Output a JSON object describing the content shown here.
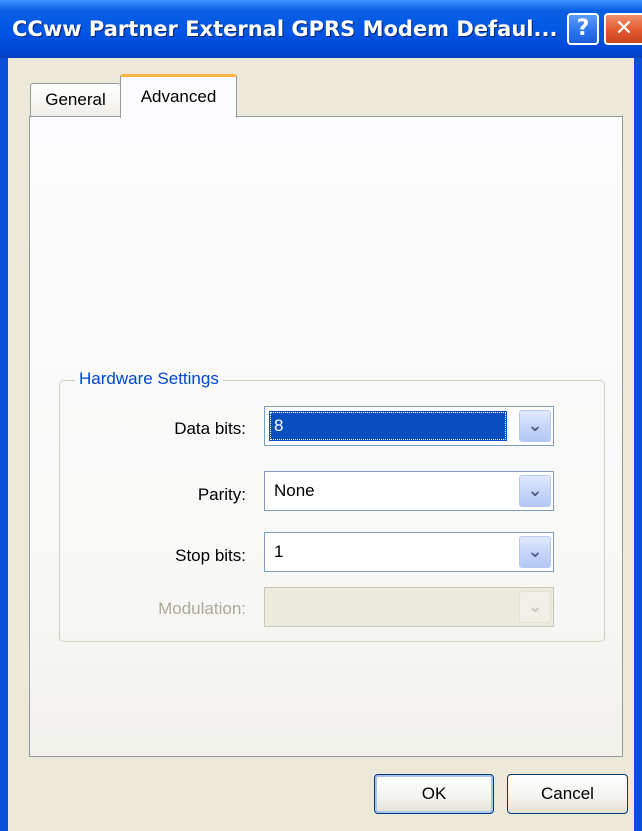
{
  "window": {
    "title": "CCww Partner External GPRS Modem Defaul...",
    "help_glyph": "?",
    "close_glyph": "✕"
  },
  "tabs": [
    {
      "label": "General",
      "active": false
    },
    {
      "label": "Advanced",
      "active": true
    }
  ],
  "hardware_settings": {
    "group_label": "Hardware Settings",
    "fields": [
      {
        "label": "Data bits:",
        "value": "8",
        "selected": true,
        "enabled": true
      },
      {
        "label": "Parity:",
        "value": "None",
        "selected": false,
        "enabled": true
      },
      {
        "label": "Stop bits:",
        "value": "1",
        "selected": false,
        "enabled": true
      },
      {
        "label": "Modulation:",
        "value": "",
        "selected": false,
        "enabled": false
      }
    ]
  },
  "buttons": {
    "ok": "OK",
    "cancel": "Cancel"
  },
  "colors": {
    "titlebar": "#0055E5",
    "group_label": "#0046D5",
    "selection": "#0A4FC2",
    "tab_highlight": "#F9B544",
    "close_button": "#E2572C"
  },
  "icons": {
    "combo_arrow": "chevron-down-icon"
  }
}
